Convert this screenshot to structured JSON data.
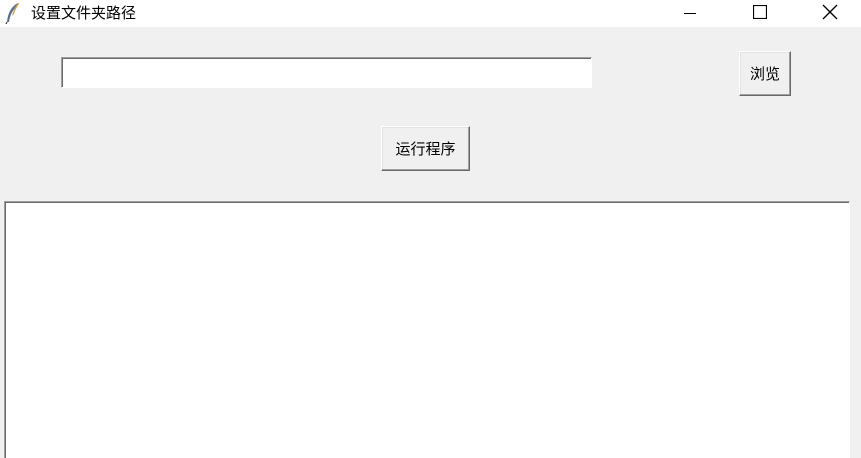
{
  "window": {
    "title": "设置文件夹路径",
    "app_icon": "feather-icon",
    "controls": {
      "minimize_icon": "minimize-icon",
      "maximize_icon": "maximize-icon",
      "close_icon": "close-icon"
    }
  },
  "form": {
    "path_value": "",
    "browse_label": "浏览",
    "run_label": "运行程序"
  },
  "output": {
    "text": ""
  },
  "colors": {
    "window_bg": "#f0f0f0",
    "titlebar_bg": "#ffffff",
    "field_bg": "#ffffff"
  }
}
